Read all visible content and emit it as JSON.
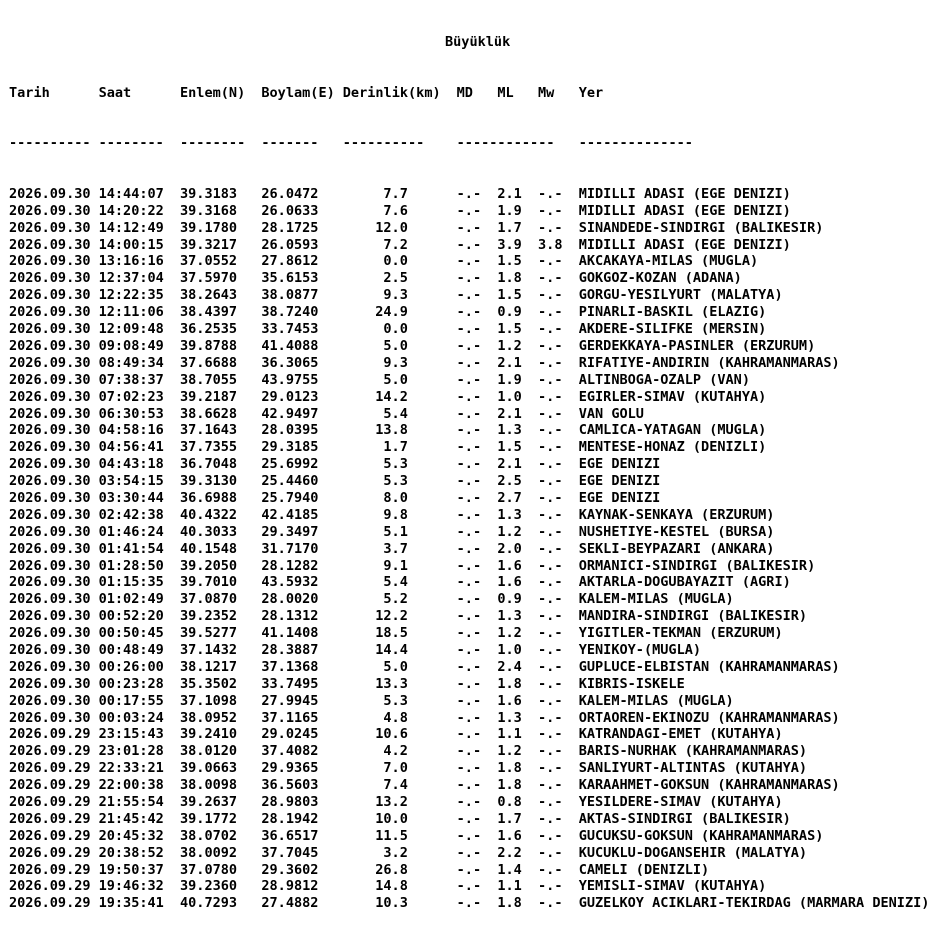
{
  "header": {
    "magnitude_group": "Büyüklük",
    "columns": {
      "date": "Tarih",
      "time": "Saat",
      "lat": "Enlem(N)",
      "lon": "Boylam(E)",
      "depth": "Derinlik(km)",
      "md": "MD",
      "ml": "ML",
      "mw": "Mw",
      "place": "Yer"
    },
    "dashes": {
      "date": "----------",
      "time": "--------",
      "lat": "--------",
      "lon": "-------",
      "depth": "----------",
      "mag": "------------",
      "place": "--------------"
    }
  },
  "rows": [
    {
      "date": "2026.09.30",
      "time": "14:44:07",
      "lat": "39.3183",
      "lon": "26.0472",
      "depth": "7.7",
      "md": "-.-",
      "ml": "2.1",
      "mw": "-.-",
      "place": "MIDILLI ADASI (EGE DENIZI)"
    },
    {
      "date": "2026.09.30",
      "time": "14:20:22",
      "lat": "39.3168",
      "lon": "26.0633",
      "depth": "7.6",
      "md": "-.-",
      "ml": "1.9",
      "mw": "-.-",
      "place": "MIDILLI ADASI (EGE DENIZI)"
    },
    {
      "date": "2026.09.30",
      "time": "14:12:49",
      "lat": "39.1780",
      "lon": "28.1725",
      "depth": "12.0",
      "md": "-.-",
      "ml": "1.7",
      "mw": "-.-",
      "place": "SINANDEDE-SINDIRGI (BALIKESIR)"
    },
    {
      "date": "2026.09.30",
      "time": "14:00:15",
      "lat": "39.3217",
      "lon": "26.0593",
      "depth": "7.2",
      "md": "-.-",
      "ml": "3.9",
      "mw": "3.8",
      "place": "MIDILLI ADASI (EGE DENIZI)"
    },
    {
      "date": "2026.09.30",
      "time": "13:16:16",
      "lat": "37.0552",
      "lon": "27.8612",
      "depth": "0.0",
      "md": "-.-",
      "ml": "1.5",
      "mw": "-.-",
      "place": "AKCAKAYA-MILAS (MUGLA)"
    },
    {
      "date": "2026.09.30",
      "time": "12:37:04",
      "lat": "37.5970",
      "lon": "35.6153",
      "depth": "2.5",
      "md": "-.-",
      "ml": "1.8",
      "mw": "-.-",
      "place": "GOKGOZ-KOZAN (ADANA)"
    },
    {
      "date": "2026.09.30",
      "time": "12:22:35",
      "lat": "38.2643",
      "lon": "38.0877",
      "depth": "9.3",
      "md": "-.-",
      "ml": "1.5",
      "mw": "-.-",
      "place": "GORGU-YESILYURT (MALATYA)"
    },
    {
      "date": "2026.09.30",
      "time": "12:11:06",
      "lat": "38.4397",
      "lon": "38.7240",
      "depth": "24.9",
      "md": "-.-",
      "ml": "0.9",
      "mw": "-.-",
      "place": "PINARLI-BASKIL (ELAZIG)"
    },
    {
      "date": "2026.09.30",
      "time": "12:09:48",
      "lat": "36.2535",
      "lon": "33.7453",
      "depth": "0.0",
      "md": "-.-",
      "ml": "1.5",
      "mw": "-.-",
      "place": "AKDERE-SILIFKE (MERSIN)"
    },
    {
      "date": "2026.09.30",
      "time": "09:08:49",
      "lat": "39.8788",
      "lon": "41.4088",
      "depth": "5.0",
      "md": "-.-",
      "ml": "1.2",
      "mw": "-.-",
      "place": "GERDEKKAYA-PASINLER (ERZURUM)"
    },
    {
      "date": "2026.09.30",
      "time": "08:49:34",
      "lat": "37.6688",
      "lon": "36.3065",
      "depth": "9.3",
      "md": "-.-",
      "ml": "2.1",
      "mw": "-.-",
      "place": "RIFATIYE-ANDIRIN (KAHRAMANMARAS)"
    },
    {
      "date": "2026.09.30",
      "time": "07:38:37",
      "lat": "38.7055",
      "lon": "43.9755",
      "depth": "5.0",
      "md": "-.-",
      "ml": "1.9",
      "mw": "-.-",
      "place": "ALTINBOGA-OZALP (VAN)"
    },
    {
      "date": "2026.09.30",
      "time": "07:02:23",
      "lat": "39.2187",
      "lon": "29.0123",
      "depth": "14.2",
      "md": "-.-",
      "ml": "1.0",
      "mw": "-.-",
      "place": "EGIRLER-SIMAV (KUTAHYA)"
    },
    {
      "date": "2026.09.30",
      "time": "06:30:53",
      "lat": "38.6628",
      "lon": "42.9497",
      "depth": "5.4",
      "md": "-.-",
      "ml": "2.1",
      "mw": "-.-",
      "place": "VAN GOLU"
    },
    {
      "date": "2026.09.30",
      "time": "04:58:16",
      "lat": "37.1643",
      "lon": "28.0395",
      "depth": "13.8",
      "md": "-.-",
      "ml": "1.3",
      "mw": "-.-",
      "place": "CAMLICA-YATAGAN (MUGLA)"
    },
    {
      "date": "2026.09.30",
      "time": "04:56:41",
      "lat": "37.7355",
      "lon": "29.3185",
      "depth": "1.7",
      "md": "-.-",
      "ml": "1.5",
      "mw": "-.-",
      "place": "MENTESE-HONAZ (DENIZLI)"
    },
    {
      "date": "2026.09.30",
      "time": "04:43:18",
      "lat": "36.7048",
      "lon": "25.6992",
      "depth": "5.3",
      "md": "-.-",
      "ml": "2.1",
      "mw": "-.-",
      "place": "EGE DENIZI"
    },
    {
      "date": "2026.09.30",
      "time": "03:54:15",
      "lat": "39.3130",
      "lon": "25.4460",
      "depth": "5.3",
      "md": "-.-",
      "ml": "2.5",
      "mw": "-.-",
      "place": "EGE DENIZI"
    },
    {
      "date": "2026.09.30",
      "time": "03:30:44",
      "lat": "36.6988",
      "lon": "25.7940",
      "depth": "8.0",
      "md": "-.-",
      "ml": "2.7",
      "mw": "-.-",
      "place": "EGE DENIZI"
    },
    {
      "date": "2026.09.30",
      "time": "02:42:38",
      "lat": "40.4322",
      "lon": "42.4185",
      "depth": "9.8",
      "md": "-.-",
      "ml": "1.3",
      "mw": "-.-",
      "place": "KAYNAK-SENKAYA (ERZURUM)"
    },
    {
      "date": "2026.09.30",
      "time": "01:46:24",
      "lat": "40.3033",
      "lon": "29.3497",
      "depth": "5.1",
      "md": "-.-",
      "ml": "1.2",
      "mw": "-.-",
      "place": "NUSHETIYE-KESTEL (BURSA)"
    },
    {
      "date": "2026.09.30",
      "time": "01:41:54",
      "lat": "40.1548",
      "lon": "31.7170",
      "depth": "3.7",
      "md": "-.-",
      "ml": "2.0",
      "mw": "-.-",
      "place": "SEKLI-BEYPAZARI (ANKARA)"
    },
    {
      "date": "2026.09.30",
      "time": "01:28:50",
      "lat": "39.2050",
      "lon": "28.1282",
      "depth": "9.1",
      "md": "-.-",
      "ml": "1.6",
      "mw": "-.-",
      "place": "ORMANICI-SINDIRGI (BALIKESIR)"
    },
    {
      "date": "2026.09.30",
      "time": "01:15:35",
      "lat": "39.7010",
      "lon": "43.5932",
      "depth": "5.4",
      "md": "-.-",
      "ml": "1.6",
      "mw": "-.-",
      "place": "AKTARLA-DOGUBAYAZIT (AGRI)"
    },
    {
      "date": "2026.09.30",
      "time": "01:02:49",
      "lat": "37.0870",
      "lon": "28.0020",
      "depth": "5.2",
      "md": "-.-",
      "ml": "0.9",
      "mw": "-.-",
      "place": "KALEM-MILAS (MUGLA)"
    },
    {
      "date": "2026.09.30",
      "time": "00:52:20",
      "lat": "39.2352",
      "lon": "28.1312",
      "depth": "12.2",
      "md": "-.-",
      "ml": "1.3",
      "mw": "-.-",
      "place": "MANDIRA-SINDIRGI (BALIKESIR)"
    },
    {
      "date": "2026.09.30",
      "time": "00:50:45",
      "lat": "39.5277",
      "lon": "41.1408",
      "depth": "18.5",
      "md": "-.-",
      "ml": "1.2",
      "mw": "-.-",
      "place": "YIGITLER-TEKMAN (ERZURUM)"
    },
    {
      "date": "2026.09.30",
      "time": "00:48:49",
      "lat": "37.1432",
      "lon": "28.3887",
      "depth": "14.4",
      "md": "-.-",
      "ml": "1.0",
      "mw": "-.-",
      "place": "YENIKOY-(MUGLA)"
    },
    {
      "date": "2026.09.30",
      "time": "00:26:00",
      "lat": "38.1217",
      "lon": "37.1368",
      "depth": "5.0",
      "md": "-.-",
      "ml": "2.4",
      "mw": "-.-",
      "place": "GUPLUCE-ELBISTAN (KAHRAMANMARAS)"
    },
    {
      "date": "2026.09.30",
      "time": "00:23:28",
      "lat": "35.3502",
      "lon": "33.7495",
      "depth": "13.3",
      "md": "-.-",
      "ml": "1.8",
      "mw": "-.-",
      "place": "KIBRIS-ISKELE"
    },
    {
      "date": "2026.09.30",
      "time": "00:17:55",
      "lat": "37.1098",
      "lon": "27.9945",
      "depth": "5.3",
      "md": "-.-",
      "ml": "1.6",
      "mw": "-.-",
      "place": "KALEM-MILAS (MUGLA)"
    },
    {
      "date": "2026.09.30",
      "time": "00:03:24",
      "lat": "38.0952",
      "lon": "37.1165",
      "depth": "4.8",
      "md": "-.-",
      "ml": "1.3",
      "mw": "-.-",
      "place": "ORTAOREN-EKINOZU (KAHRAMANMARAS)"
    },
    {
      "date": "2026.09.29",
      "time": "23:15:43",
      "lat": "39.2410",
      "lon": "29.0245",
      "depth": "10.6",
      "md": "-.-",
      "ml": "1.1",
      "mw": "-.-",
      "place": "KATRANDAGI-EMET (KUTAHYA)"
    },
    {
      "date": "2026.09.29",
      "time": "23:01:28",
      "lat": "38.0120",
      "lon": "37.4082",
      "depth": "4.2",
      "md": "-.-",
      "ml": "1.2",
      "mw": "-.-",
      "place": "BARIS-NURHAK (KAHRAMANMARAS)"
    },
    {
      "date": "2026.09.29",
      "time": "22:33:21",
      "lat": "39.0663",
      "lon": "29.9365",
      "depth": "7.0",
      "md": "-.-",
      "ml": "1.8",
      "mw": "-.-",
      "place": "SANLIYURT-ALTINTAS (KUTAHYA)"
    },
    {
      "date": "2026.09.29",
      "time": "22:00:38",
      "lat": "38.0098",
      "lon": "36.5603",
      "depth": "7.4",
      "md": "-.-",
      "ml": "1.8",
      "mw": "-.-",
      "place": "KARAAHMET-GOKSUN (KAHRAMANMARAS)"
    },
    {
      "date": "2026.09.29",
      "time": "21:55:54",
      "lat": "39.2637",
      "lon": "28.9803",
      "depth": "13.2",
      "md": "-.-",
      "ml": "0.8",
      "mw": "-.-",
      "place": "YESILDERE-SIMAV (KUTAHYA)"
    },
    {
      "date": "2026.09.29",
      "time": "21:45:42",
      "lat": "39.1772",
      "lon": "28.1942",
      "depth": "10.0",
      "md": "-.-",
      "ml": "1.7",
      "mw": "-.-",
      "place": "AKTAS-SINDIRGI (BALIKESIR)"
    },
    {
      "date": "2026.09.29",
      "time": "20:45:32",
      "lat": "38.0702",
      "lon": "36.6517",
      "depth": "11.5",
      "md": "-.-",
      "ml": "1.6",
      "mw": "-.-",
      "place": "GUCUKSU-GOKSUN (KAHRAMANMARAS)"
    },
    {
      "date": "2026.09.29",
      "time": "20:38:52",
      "lat": "38.0092",
      "lon": "37.7045",
      "depth": "3.2",
      "md": "-.-",
      "ml": "2.2",
      "mw": "-.-",
      "place": "KUCUKLU-DOGANSEHIR (MALATYA)"
    },
    {
      "date": "2026.09.29",
      "time": "19:50:37",
      "lat": "37.0780",
      "lon": "29.3602",
      "depth": "26.8",
      "md": "-.-",
      "ml": "1.4",
      "mw": "-.-",
      "place": "CAMELI (DENIZLI)"
    },
    {
      "date": "2026.09.29",
      "time": "19:46:32",
      "lat": "39.2360",
      "lon": "28.9812",
      "depth": "14.8",
      "md": "-.-",
      "ml": "1.1",
      "mw": "-.-",
      "place": "YEMISLI-SIMAV (KUTAHYA)"
    },
    {
      "date": "2026.09.29",
      "time": "19:35:41",
      "lat": "40.7293",
      "lon": "27.4882",
      "depth": "10.3",
      "md": "-.-",
      "ml": "1.8",
      "mw": "-.-",
      "place": "GUZELKOY ACIKLARI-TEKIRDAG (MARMARA DENIZI)"
    }
  ]
}
